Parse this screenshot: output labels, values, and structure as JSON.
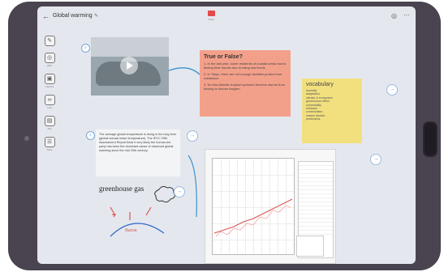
{
  "window": {
    "title": "Global warming",
    "deck_label": "Deck"
  },
  "toolbar": {
    "tools": [
      {
        "label": ""
      },
      {
        "label": "Web"
      },
      {
        "label": "Camera"
      },
      {
        "label": "Link"
      },
      {
        "label": "File"
      },
      {
        "label": "Tools"
      }
    ]
  },
  "cards": {
    "quiz_title": "True or False?",
    "quiz_items": [
      "1. In the last year, some residents of coastal areas had to fleeing their homes due to rising sea levels.",
      "2. In Tokyo, there are not enough facilities protect from resistance.",
      "3. No less Atlantic tropical cyclones become storms from flowing to storms happen."
    ],
    "vocab_title": "vocabulary",
    "vocab_items": [
      "humidity",
      "adaptation",
      "climate & ecosystem",
      "greenhouse effect",
      "vulnerability",
      "emission",
      "conservation",
      "carbon dioxide",
      "predictions"
    ],
    "paragraph": "The average global temperature is rising in the long term (global annual mean temperature). The IPCC Fifth Assessment Report finds it very likely the human-led party has been the dominant cause of observed global warming since the mid 20th century.",
    "sketch_title": "greenhouse gas",
    "sketch_word": "Baron"
  },
  "colors": {
    "quiz": "#f3a08b",
    "vocab": "#f2e07f",
    "accent": "#7aa8d8",
    "trend": "#d9534f"
  }
}
